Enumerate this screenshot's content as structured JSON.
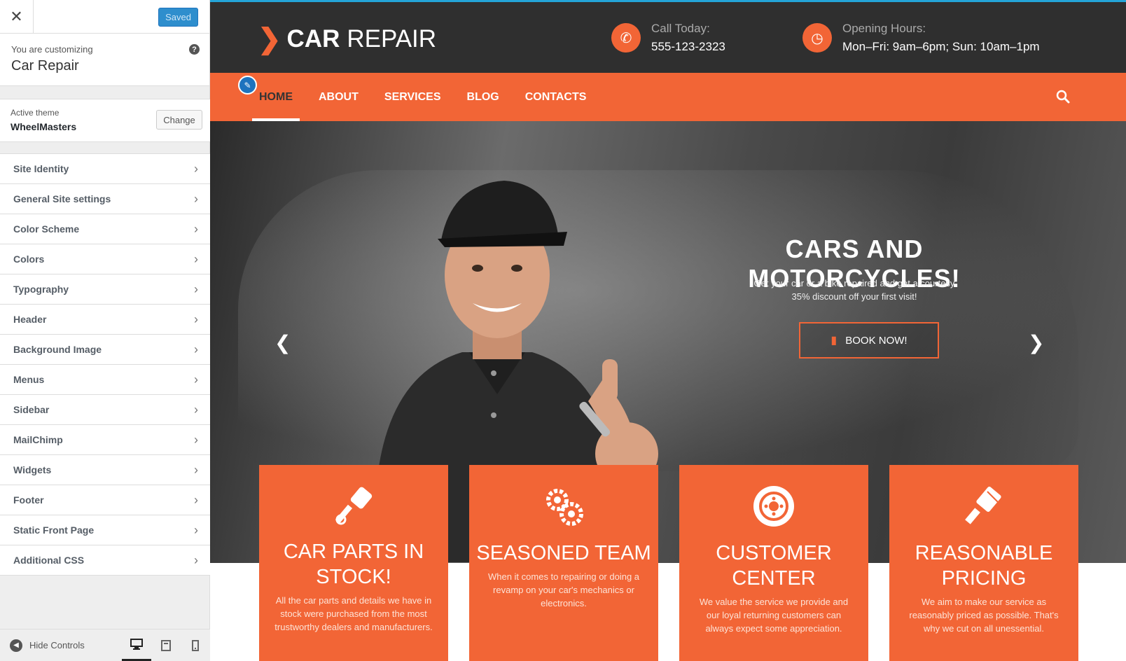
{
  "customizer": {
    "saved_label": "Saved",
    "customizing_label": "You are customizing",
    "site_name": "Car Repair",
    "active_theme_label": "Active theme",
    "theme_name": "WheelMasters",
    "change_label": "Change",
    "menu": [
      {
        "label": "Site Identity"
      },
      {
        "label": "General Site settings"
      },
      {
        "label": "Color Scheme"
      },
      {
        "label": "Colors"
      },
      {
        "label": "Typography"
      },
      {
        "label": "Header"
      },
      {
        "label": "Background Image"
      },
      {
        "label": "Menus"
      },
      {
        "label": "Sidebar"
      },
      {
        "label": "MailChimp"
      },
      {
        "label": "Widgets"
      },
      {
        "label": "Footer"
      },
      {
        "label": "Static Front Page"
      },
      {
        "label": "Additional CSS"
      }
    ],
    "hide_controls_label": "Hide Controls",
    "devices": [
      "desktop-icon",
      "tablet-icon",
      "mobile-icon"
    ],
    "active_device": "desktop"
  },
  "site": {
    "logo_bold": "CAR",
    "logo_light": "REPAIR",
    "call_label": "Call Today:",
    "phone": "555-123-2323",
    "hours_label": "Opening Hours:",
    "hours": "Mon–Fri: 9am–6pm; Sun: 10am–1pm",
    "nav": [
      "HOME",
      "ABOUT",
      "SERVICES",
      "BLOG",
      "CONTACTS"
    ],
    "active_nav": "HOME",
    "hero": {
      "title": "CARS AND MOTORCYCLES!",
      "text": "Get your car or a bike repaired and get a courtesy 35% discount off your first visit!",
      "button": "BOOK NOW!"
    },
    "features": [
      {
        "icon": "piston-icon",
        "title": "CAR PARTS IN STOCK!",
        "text": "All the car parts and details we have in stock were purchased from the most trustworthy dealers and manufacturers."
      },
      {
        "icon": "gears-icon",
        "title": "SEASONED TEAM",
        "text": "When it comes to repairing or doing a revamp on your car's mechanics or electronics."
      },
      {
        "icon": "brake-disc-icon",
        "title": "CUSTOMER CENTER",
        "text": "We value the service we provide and our loyal returning customers can always expect some appreciation."
      },
      {
        "icon": "paint-brush-icon",
        "title": "REASONABLE PRICING",
        "text": "We aim to make our service as reasonably priced as possible. That's why we cut on all unessential."
      }
    ]
  },
  "colors": {
    "accent": "#f26536",
    "header_bg": "#2f2f2f",
    "wp_blue": "#2e8ecd"
  }
}
